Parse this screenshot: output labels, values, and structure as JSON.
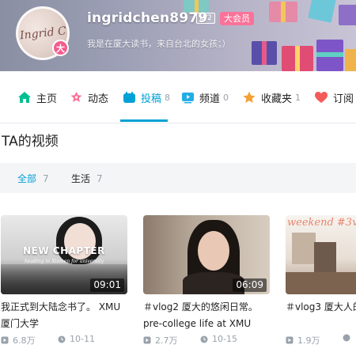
{
  "profile": {
    "avatar_signature": "Ingrid Chen",
    "avatar_badge": "大",
    "username": "ingridchen8979",
    "level": "LV2",
    "vip": "大会员",
    "bio": "我是在厦大读书，来自台北的女孩；）"
  },
  "nav": {
    "items": [
      {
        "label": "主页",
        "count": "",
        "icon": "home-icon",
        "color": "#00c091"
      },
      {
        "label": "动态",
        "count": "",
        "icon": "dynamic-icon",
        "color": "#fb7299"
      },
      {
        "label": "投稿",
        "count": "8",
        "icon": "upload-icon",
        "color": "#00a1d6",
        "active": true
      },
      {
        "label": "频道",
        "count": "0",
        "icon": "channel-icon",
        "color": "#23ade5"
      },
      {
        "label": "收藏夹",
        "count": "1",
        "icon": "star-icon",
        "color": "#f3a034"
      },
      {
        "label": "订阅",
        "count": "",
        "icon": "heart-icon",
        "color": "#f45a5a"
      }
    ]
  },
  "section": {
    "title": "TA的视频",
    "filters": [
      {
        "label": "全部",
        "count": "7",
        "active": true
      },
      {
        "label": "生活",
        "count": "7",
        "active": false
      }
    ]
  },
  "videos": [
    {
      "thumb_text": "NEW CHAPTER",
      "thumb_subtext": "heading to Xiamen for university",
      "duration": "09:01",
      "title": "我正式到大陆念书了。 XMU 厦门大学",
      "views": "6.8万",
      "date": "10-11"
    },
    {
      "thumb_text": "",
      "thumb_subtext": "",
      "duration": "06:09",
      "title": "＃vlog2 厦大的悠闲日常。 pre-college life at XMU",
      "views": "2.7万",
      "date": "10-15"
    },
    {
      "thumb_text": "weekend #3v",
      "thumb_subtext": "",
      "duration": "",
      "title": "＃vlog3 厦大人的",
      "views": "1.9万",
      "date": ""
    }
  ],
  "colors": {
    "accent": "#00a1d6",
    "vip": "#fb7299",
    "muted": "#99a2aa"
  }
}
